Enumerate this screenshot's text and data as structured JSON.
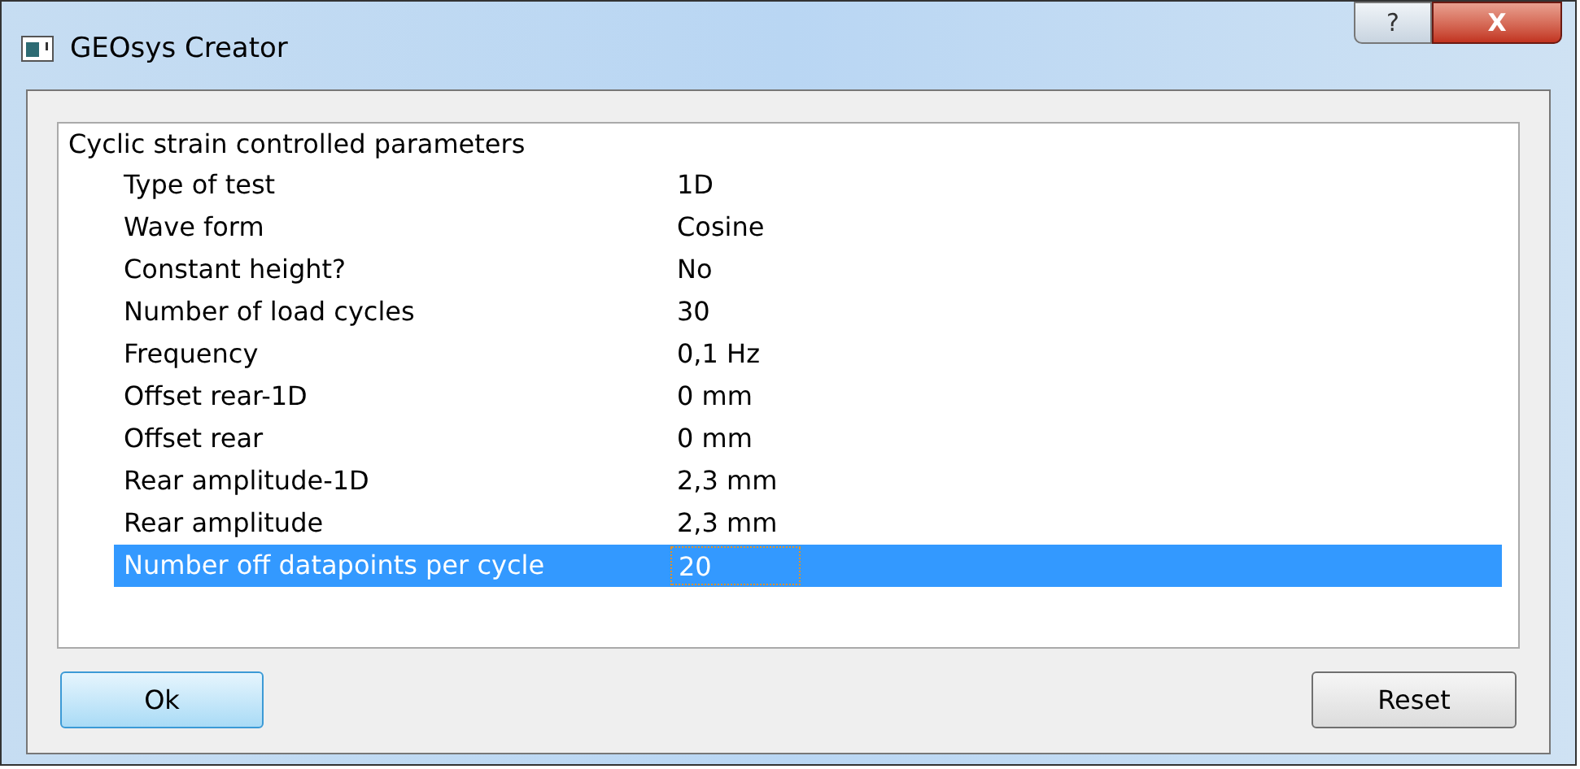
{
  "window": {
    "title": "GEOsys Creator",
    "help": "?",
    "close": "X"
  },
  "tree": {
    "group": "Cyclic strain controlled parameters",
    "rows": [
      {
        "label": "Type of test",
        "value": "1D",
        "selected": false
      },
      {
        "label": "Wave form",
        "value": "Cosine",
        "selected": false
      },
      {
        "label": "Constant height?",
        "value": "No",
        "selected": false
      },
      {
        "label": "Number of load cycles",
        "value": "30",
        "selected": false
      },
      {
        "label": "Frequency",
        "value": "0,1 Hz",
        "selected": false
      },
      {
        "label": "Offset rear-1D",
        "value": "0 mm",
        "selected": false
      },
      {
        "label": "Offset rear",
        "value": "0 mm",
        "selected": false
      },
      {
        "label": "Rear amplitude-1D",
        "value": "2,3 mm",
        "selected": false
      },
      {
        "label": "Rear amplitude",
        "value": "2,3 mm",
        "selected": false
      },
      {
        "label": "Number off datapoints per cycle",
        "value": "20",
        "selected": true
      }
    ]
  },
  "buttons": [
    {
      "label": "Ok",
      "default": true
    },
    {
      "label": "Reset",
      "default": false
    }
  ]
}
